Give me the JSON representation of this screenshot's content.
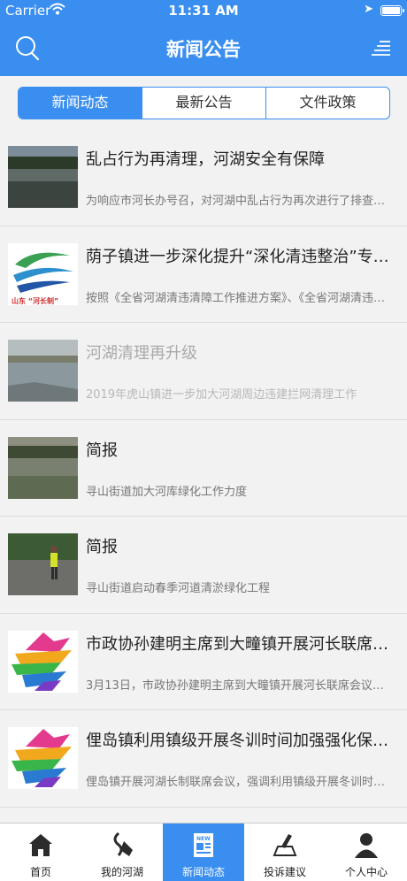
{
  "status": {
    "carrier": "Carrier",
    "time": "11:31 AM"
  },
  "nav": {
    "title": "新闻公告",
    "search_icon": "search-icon",
    "menu_icon": "menu-icon"
  },
  "segments": [
    {
      "label": "新闻动态",
      "active": true
    },
    {
      "label": "最新公告",
      "active": false
    },
    {
      "label": "文件政策",
      "active": false
    }
  ],
  "news": [
    {
      "title": "乱占行为再清理，河湖安全有保障",
      "desc": "为响应市河长办号召，对河湖中乱占行为再次进行了排查清除",
      "thumb": "river-photo",
      "dim": false
    },
    {
      "title": "荫子镇进一步深化提升“深化清违整治”专项行动",
      "desc": "按照《全省河湖清违清障工作推进方案》、《全省河湖清违清障工作推进",
      "thumb": "shandong-hezhang-logo",
      "logo_text": "山东 “河长制”",
      "dim": false
    },
    {
      "title": "河湖清理再升级",
      "desc": "2019年虎山镇进一步加大河湖周边违建拦网清理工作",
      "thumb": "lake-photo",
      "dim": true
    },
    {
      "title": "简报",
      "desc": "寻山街道加大河库绿化工作力度",
      "thumb": "reservoir-photo",
      "dim": false
    },
    {
      "title": "简报",
      "desc": "寻山街道启动春季河道清淤绿化工程",
      "thumb": "worker-photo",
      "dim": false
    },
    {
      "title": "市政协孙建明主席到大疃镇开展河长联席会议",
      "desc": "3月13日，市政协孙建明主席到大疃镇开展河长联席会议。会议听取",
      "thumb": "rainbow-logo",
      "dim": false
    },
    {
      "title": "俚岛镇利用镇级开展冬训时间加强强化保护河湖意识",
      "desc": "俚岛镇开展河湖长制联席会议，强调利用镇级开展冬训时间加强",
      "thumb": "rainbow-logo",
      "dim": false
    },
    {
      "title": "",
      "desc": "",
      "thumb": "rainbow-logo",
      "dim": false
    }
  ],
  "tabs": [
    {
      "label": "首页",
      "icon": "home-icon",
      "active": false
    },
    {
      "label": "我的河湖",
      "icon": "my-river-icon",
      "active": false
    },
    {
      "label": "新闻动态",
      "icon": "news-icon",
      "active": true
    },
    {
      "label": "投诉建议",
      "icon": "complaint-icon",
      "active": false
    },
    {
      "label": "个人中心",
      "icon": "person-icon",
      "active": false
    }
  ],
  "colors": {
    "primary": "#3a8ef0",
    "background": "#f2f2f2"
  }
}
